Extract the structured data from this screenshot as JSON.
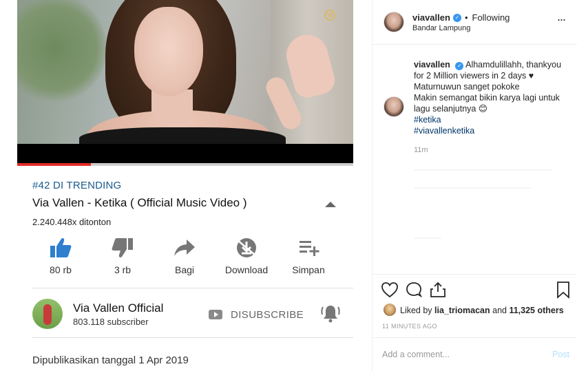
{
  "youtube": {
    "video": {
      "watermark": "W",
      "progress_fraction": 0.22
    },
    "trending_label": "#42 DI TRENDING",
    "title": "Via Vallen - Ketika ( Official Music Video )",
    "views": "2.240.448x ditonton",
    "actions": [
      {
        "icon": "thumbs-up-icon",
        "label": "80 rb"
      },
      {
        "icon": "thumbs-down-icon",
        "label": "3 rb"
      },
      {
        "icon": "share-icon",
        "label": "Bagi"
      },
      {
        "icon": "download-icon",
        "label": "Download"
      },
      {
        "icon": "playlist-add-icon",
        "label": "Simpan"
      }
    ],
    "channel": {
      "name": "Via Vallen Official",
      "subscribers": "803.118 subscriber",
      "subscribe_label": "DISUBSCRIBE"
    },
    "published": "Dipublikasikan tanggal 1 Apr 2019",
    "colors": {
      "link_blue": "#1a5a8c",
      "progress_red": "#e52d27",
      "like_blue": "#2f7fcf"
    }
  },
  "instagram": {
    "header": {
      "username": "viavallen",
      "separator": "•",
      "follow_status": "Following",
      "location": "Bandar Lampung",
      "more": "..."
    },
    "caption": {
      "username": "viavallen",
      "line1": "Alhamdulillahh, thankyou for 2 Million viewers in 2 days ♥",
      "line2": "Maturnuwun sanget pokoke",
      "line3": "Makin semangat bikin karya lagi untuk lagu selanjutnya 😊",
      "hashtag1": "#ketika",
      "hashtag2": "#viavallenketika",
      "time": "11m"
    },
    "likes": {
      "prefix": "Liked by",
      "user": "lia_triomacan",
      "middle": "and",
      "count": "11,325 others"
    },
    "post_age": "11 MINUTES AGO",
    "comment_placeholder": "Add a comment...",
    "post_label": "Post",
    "colors": {
      "verified": "#3897f0",
      "hashtag": "#003569",
      "post_disabled": "#b2dffc"
    }
  }
}
